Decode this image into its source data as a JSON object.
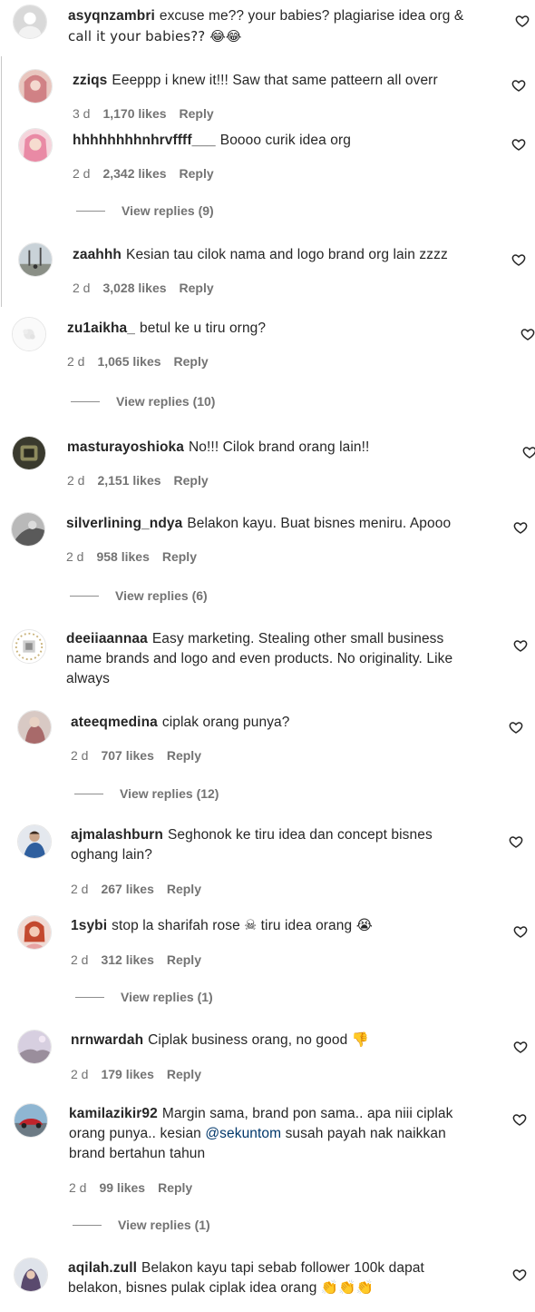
{
  "comments": [
    {
      "user": "asyqnzambri",
      "text": "excuse me?? your babies? plagiarise idea org &",
      "text2": "call it your babies?? 😂😂"
    },
    {
      "user": "zziqs",
      "text": "Eeeppp i knew it!!! Saw that same patteern all overr",
      "time": "3 d",
      "likes": "1,170 likes",
      "reply": "Reply"
    },
    {
      "user": "hhhhhhhhnhrvffff___",
      "text": "Boooo curik idea org",
      "time": "2 d",
      "likes": "2,342 likes",
      "reply": "Reply",
      "view": "View replies (9)"
    },
    {
      "user": "zaahhh",
      "text": "Kesian tau cilok nama and logo brand org lain zzzz",
      "time": "2 d",
      "likes": "3,028 likes",
      "reply": "Reply"
    },
    {
      "user": "zu1aikha_",
      "text": "betul ke u tiru orng?",
      "time": "2 d",
      "likes": "1,065 likes",
      "reply": "Reply",
      "view": "View replies (10)"
    },
    {
      "user": "masturayoshioka",
      "text": "No!!! Cilok brand orang lain!!",
      "time": "2 d",
      "likes": "2,151 likes",
      "reply": "Reply"
    },
    {
      "user": "silverlining_ndya",
      "text": "Belakon kayu. Buat bisnes meniru. Apooo",
      "time": "2 d",
      "likes": "958 likes",
      "reply": "Reply",
      "view": "View replies (6)"
    },
    {
      "user": "deeiiaannaa",
      "text": "Easy marketing. Stealing other small business",
      "text2": "name brands and logo and even products. No originality. Like",
      "text3": "always"
    },
    {
      "user": "ateeqmedina",
      "text": "ciplak orang punya?",
      "time": "2 d",
      "likes": "707 likes",
      "reply": "Reply",
      "view": "View replies (12)"
    },
    {
      "user": "ajmalashburn",
      "text": "Seghonok ke tiru idea dan concept bisnes",
      "text2": "oghang lain?",
      "time": "2 d",
      "likes": "267 likes",
      "reply": "Reply"
    },
    {
      "user": "1sybi",
      "text": "stop la sharifah rose ☠ tiru idea orang 😭",
      "time": "2 d",
      "likes": "312 likes",
      "reply": "Reply",
      "view": "View replies (1)"
    },
    {
      "user": "nrnwardah",
      "text": "Ciplak business orang, no good 👎",
      "time": "2 d",
      "likes": "179 likes",
      "reply": "Reply"
    },
    {
      "user": "kamilazikir92",
      "text": "Margin sama, brand pon sama.. apa niii ciplak",
      "text2a": "orang punya.. kesian ",
      "mention": "@sekuntom",
      "text2b": " susah payah nak naikkan",
      "text3": "brand bertahun tahun",
      "time": "2 d",
      "likes": "99 likes",
      "reply": "Reply",
      "view": "View replies (1)"
    },
    {
      "user": "aqilah.zull",
      "text": "Belakon kayu tapi sebab follower 100k dapat",
      "text2": "belakon, bisnes pulak ciplak idea orang 👏👏👏"
    }
  ],
  "colors": {
    "text": "#262626",
    "muted": "#737373",
    "mention": "#00376b"
  },
  "icons": {
    "like": "heart-outline-icon"
  }
}
